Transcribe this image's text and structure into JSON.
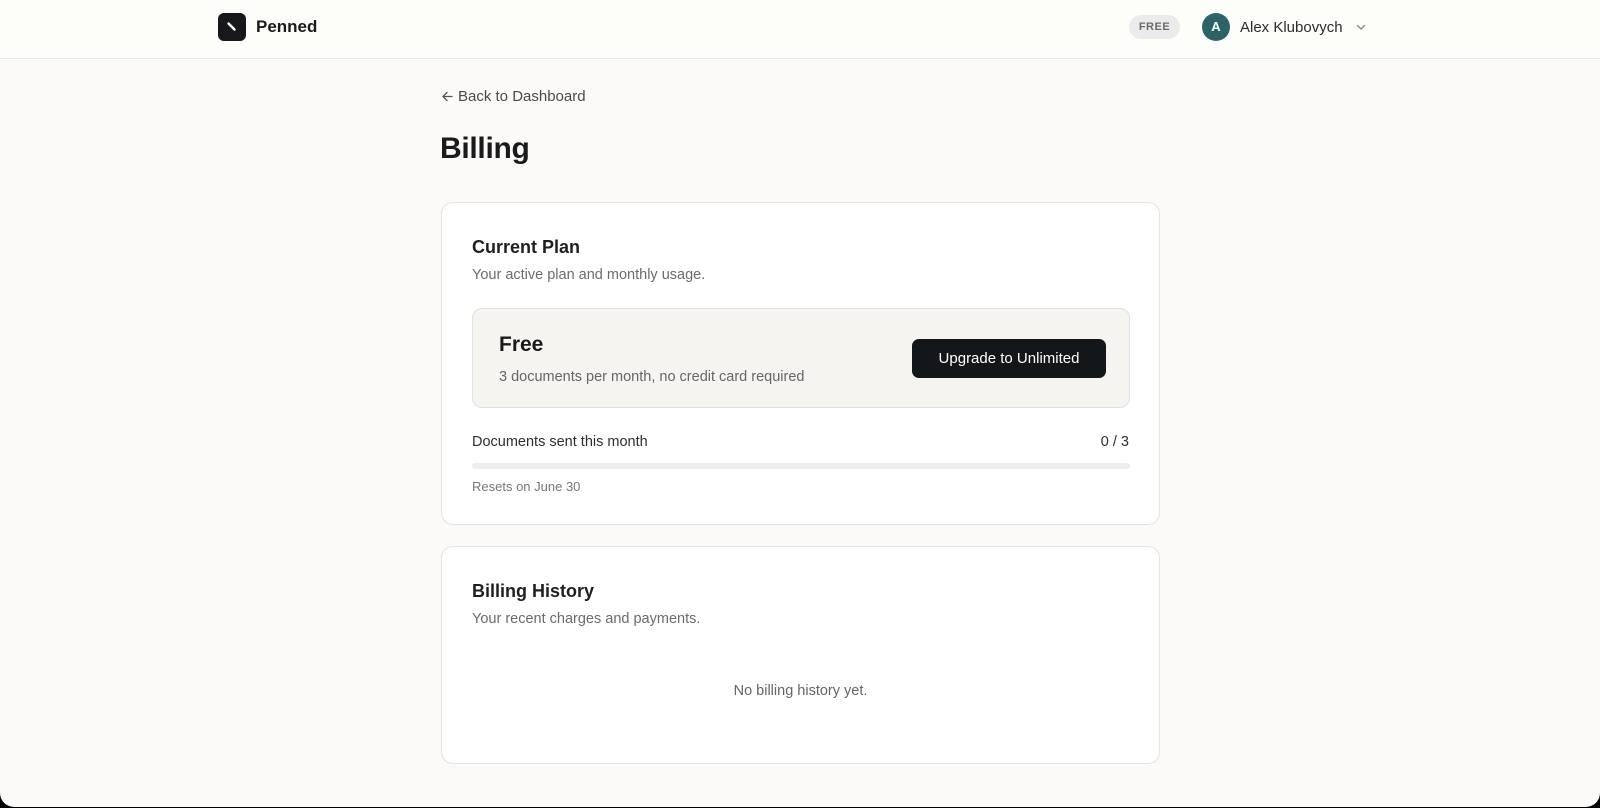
{
  "header": {
    "brand_name": "Penned",
    "plan_badge": "FREE",
    "user": {
      "avatar_initial": "A",
      "name": "Alex Klubovych"
    }
  },
  "nav": {
    "back_link": "Back to Dashboard"
  },
  "page": {
    "title": "Billing"
  },
  "current_plan": {
    "title": "Current Plan",
    "subtitle": "Your active plan and monthly usage.",
    "plan_name": "Free",
    "plan_description": "3 documents per month, no credit card required",
    "upgrade_label": "Upgrade to Unlimited",
    "usage": {
      "label": "Documents sent this month",
      "count_text": "0 / 3",
      "used": 0,
      "limit": 3,
      "progress_fraction": 0
    },
    "reset_note": "Resets on June 30"
  },
  "billing_history": {
    "title": "Billing History",
    "subtitle": "Your recent charges and payments.",
    "empty_message": "No billing history yet."
  },
  "icons": {
    "logo": "pen-icon",
    "back": "arrow-left-icon",
    "user_menu": "chevron-down-icon"
  },
  "colors": {
    "brand_dark": "#14171a",
    "avatar_bg": "#2b6366",
    "page_bg": "#fbfaf8",
    "plan_box_bg": "#f6f4f1"
  }
}
